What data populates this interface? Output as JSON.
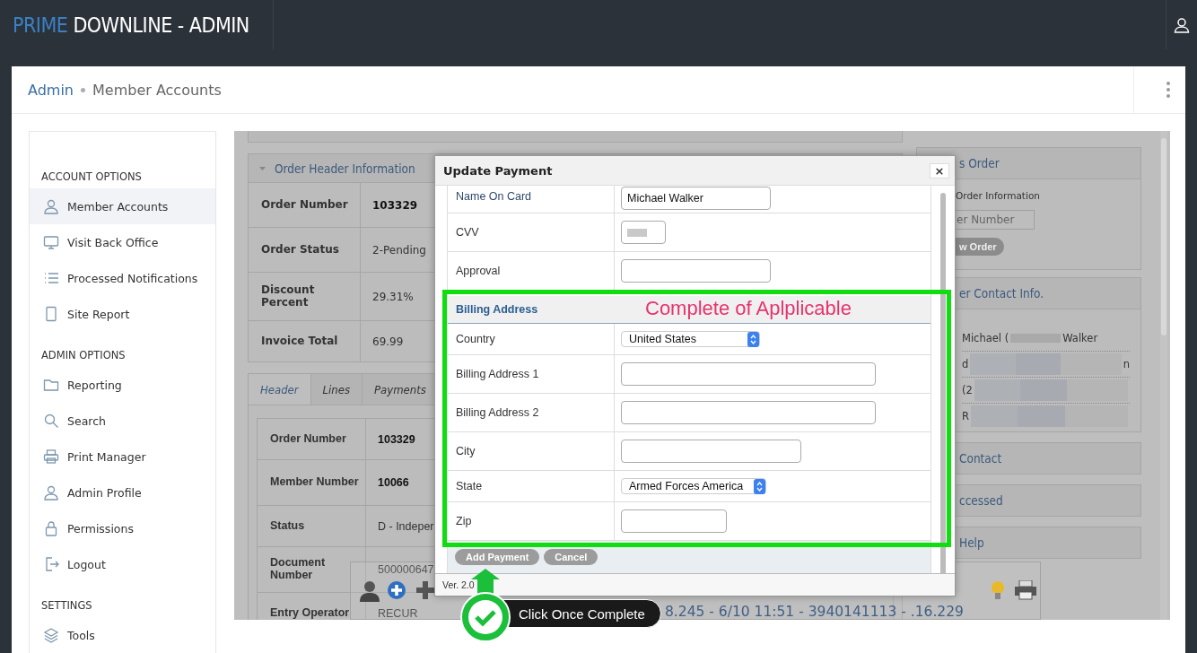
{
  "app": {
    "logo_primary": "PRIME",
    "logo_secondary": "DOWNLINE - ADMIN"
  },
  "breadcrumb": [
    {
      "label": "Admin",
      "kind": "link"
    },
    {
      "label": "Member Accounts",
      "kind": "current"
    }
  ],
  "sidebar": {
    "sections": [
      {
        "title": "ACCOUNT OPTIONS",
        "items": [
          {
            "label": "Member Accounts",
            "selected": true
          },
          {
            "label": "Visit Back Office",
            "selected": false
          },
          {
            "label": "Processed Notifications",
            "selected": false
          },
          {
            "label": "Site Report",
            "selected": false
          }
        ]
      },
      {
        "title": "ADMIN OPTIONS",
        "items": [
          {
            "label": "Reporting",
            "selected": false
          },
          {
            "label": "Search",
            "selected": false
          },
          {
            "label": "Print Manager",
            "selected": false
          },
          {
            "label": "Admin Profile",
            "selected": false
          },
          {
            "label": "Permissions",
            "selected": false
          },
          {
            "label": "Logout",
            "selected": false
          }
        ]
      },
      {
        "title": "SETTINGS",
        "items": [
          {
            "label": "Tools",
            "selected": false
          }
        ]
      }
    ]
  },
  "order_header": {
    "title": "Order Header Information",
    "rows": [
      {
        "label": "Order Number",
        "value": "103329",
        "strong": true
      },
      {
        "label": "Order Status",
        "value": "2-Pending",
        "strong": false
      },
      {
        "label": "Discount Percent",
        "value": "29.31%",
        "strong": false
      },
      {
        "label": "Invoice Total",
        "value": "69.99",
        "strong": false
      }
    ]
  },
  "detail_tabs": [
    {
      "label": "Header",
      "selected": true
    },
    {
      "label": "Lines",
      "selected": false
    },
    {
      "label": "Payments",
      "selected": false
    }
  ],
  "detail_rows": [
    {
      "label": "Order Number",
      "value": "103329",
      "strong": true
    },
    {
      "label": "Member Number",
      "value": "10066",
      "strong": true
    },
    {
      "label": "Status",
      "value": "D - Indeper",
      "strong": false
    },
    {
      "label": "Document Number",
      "value": "500000647",
      "strong": false
    },
    {
      "label": "Entry Operator",
      "value": "RECUR",
      "strong": false
    }
  ],
  "toolbar": {
    "status_text": "8.245 - 6/10 11:51 - 3940141113 - .16.229"
  },
  "side_panels": [
    {
      "title": "s Order",
      "kind": "form",
      "label": "Order Information",
      "placeholder": "er Number",
      "button": "w Order"
    },
    {
      "title": "er Contact Info.",
      "kind": "contact",
      "lines": [
        [
          "Michael (",
          "Walker"
        ],
        [
          "d",
          "n"
        ],
        [
          "(2"
        ],
        [
          "R"
        ]
      ]
    },
    {
      "title": "Contact",
      "kind": "header"
    },
    {
      "title": "ccessed",
      "kind": "header"
    },
    {
      "title": "Help",
      "kind": "header"
    }
  ],
  "modal": {
    "title": "Update Payment",
    "close": "×",
    "rows": [
      {
        "kind": "text",
        "label": "Name On Card",
        "value": "Michael Walker"
      },
      {
        "kind": "secret",
        "label": "CVV"
      },
      {
        "kind": "text",
        "label": "Approval"
      },
      {
        "kind": "section",
        "label": "Billing Address"
      },
      {
        "kind": "select",
        "label": "Country",
        "value": "United States"
      },
      {
        "kind": "text",
        "label": "Billing Address 1"
      },
      {
        "kind": "text",
        "label": "Billing Address 2"
      },
      {
        "kind": "text",
        "label": "City"
      },
      {
        "kind": "select",
        "label": "State",
        "value": "Armed Forces America"
      },
      {
        "kind": "text",
        "label": "Zip"
      }
    ],
    "buttons": [
      "Add Payment",
      "Cancel"
    ],
    "footer": "Ver. 2.0"
  },
  "annotations": {
    "note": "Complete of Aplplicable",
    "callout": "Click Once Complete"
  }
}
